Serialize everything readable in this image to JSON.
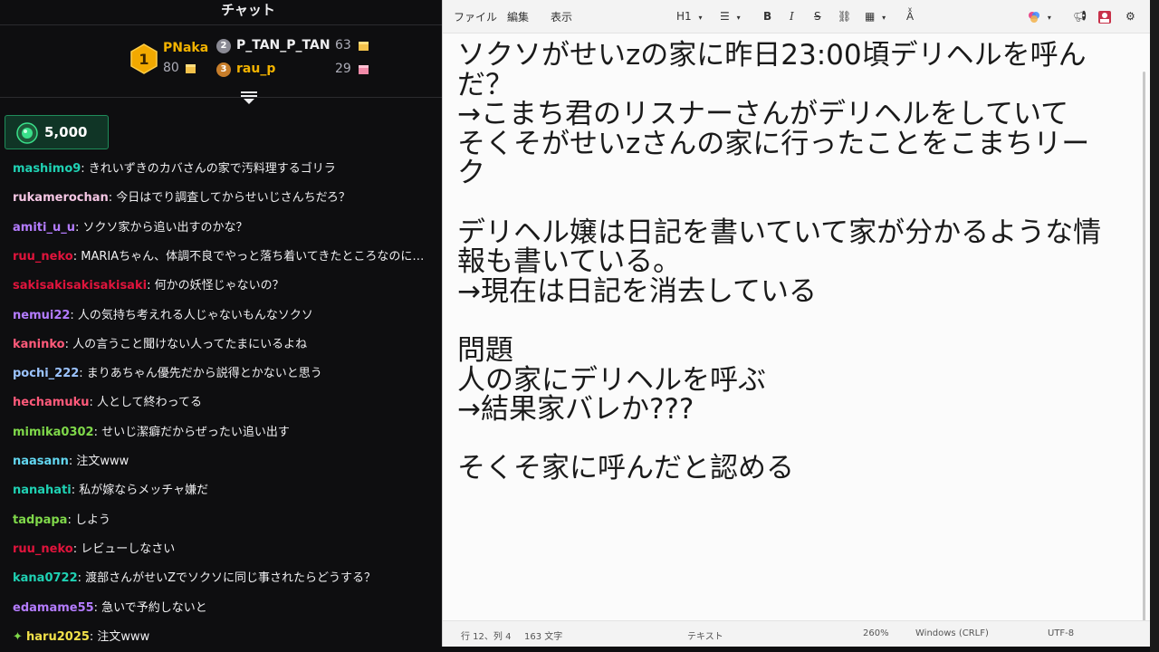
{
  "chat": {
    "title": "チャット",
    "leaderboard": {
      "first": {
        "name": "PNaka",
        "score": "80"
      },
      "second": {
        "name": "P_TAN_P_TAN",
        "score": "63",
        "rank": "2"
      },
      "third": {
        "name": "rau_p",
        "score": "29",
        "rank": "3"
      },
      "first_rank": "1"
    },
    "gift_amount": "5,000",
    "messages": [
      {
        "user": "mashimo9",
        "text": ": きれいずきのカバさんの家で汚料理するゴリラ",
        "color": "#1fd1b3"
      },
      {
        "user": "rukamerochan",
        "text": ": 今日はでり調査してからせいじさんちだろ？",
        "color": "#f5c6e4"
      },
      {
        "user": "amiti_u_u",
        "text": ": ソクソ家から追い出すのかな？",
        "color": "#b47cff"
      },
      {
        "user": "ruu_neko",
        "text": ": MARIAちゃん、体調不良でやっと落ち着いてきたところなのに…",
        "color": "#e0143c"
      },
      {
        "user": "sakisakisakisakisaki",
        "text": ": 何かの妖怪じゃないの？",
        "color": "#e0143c"
      },
      {
        "user": "nemui22",
        "text": ": 人の気持ち考えれる人じゃないもんなソクソ",
        "color": "#b47cff"
      },
      {
        "user": "kaninko",
        "text": ": 人の言うこと聞けない人ってたまにいるよね",
        "color": "#ff5a7a"
      },
      {
        "user": "pochi_222",
        "text": ": まりあちゃん優先だから説得とかないと思う",
        "color": "#9cc4ff"
      },
      {
        "user": "hechamuku",
        "text": ": 人として終わってる",
        "color": "#ff5a7a"
      },
      {
        "user": "mimika0302",
        "text": ": せいじ潔癖だからぜったい追い出す",
        "color": "#7fd84a"
      },
      {
        "user": "naasann",
        "text": ": 注文www",
        "color": "#62d6f0"
      },
      {
        "user": "nanahati",
        "text": ": 私が嫁ならメッチャ嫌だ",
        "color": "#1fd1b3"
      },
      {
        "user": "tadpapa",
        "text": ": しよう",
        "color": "#7fd84a"
      },
      {
        "user": "ruu_neko",
        "text": ": レビューしなさい",
        "color": "#e0143c"
      },
      {
        "user": "kana0722",
        "text": ": 渡部さんがせいZでソクソに同じ事されたらどうする？",
        "color": "#1fd1b3"
      },
      {
        "user": "edamame55",
        "text": ": 急いで予約しないと",
        "color": "#b47cff"
      },
      {
        "user": "haru2025",
        "text": ": 注文www",
        "color": "#f2e14a"
      }
    ]
  },
  "notepad": {
    "menu": [
      "ファイル",
      "編集",
      "表示"
    ],
    "toolbar": {
      "heading": "H1",
      "bold": "B",
      "italic": "I",
      "strike": "S"
    },
    "document_lines": [
      "ソクソがせいzの家に昨日23:00頃デリヘルを呼ん",
      "だ？",
      "→こまち君のリスナーさんがデリヘルをしていて",
      "そくそがせいzさんの家に行ったことをこまちリー",
      "ク",
      "",
      "デリヘル嬢は日記を書いていて家が分かるような情",
      "報も書いている。",
      "→現在は日記を消去している",
      "",
      "問題",
      "人の家にデリヘルを呼ぶ",
      "→結果家バレか???",
      "",
      "そくそ家に呼んだと認める"
    ],
    "status": {
      "position": "行 12、列 4",
      "chars": "163 文字",
      "format": "テキスト",
      "zoom": "260%",
      "line_ending": "Windows (CRLF)",
      "encoding": "UTF-8"
    }
  }
}
